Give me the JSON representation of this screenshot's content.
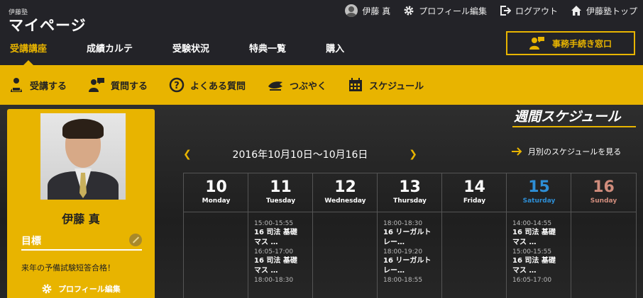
{
  "header": {
    "brand_small": "伊藤塾",
    "brand_title": "マイページ",
    "user_name": "伊藤 真",
    "profile_edit": "プロフィール編集",
    "logout": "ログアウト",
    "home": "伊藤塾トップ",
    "office_button": "事務手続き窓口"
  },
  "nav": {
    "tabs": [
      {
        "label": "受講講座",
        "active": true
      },
      {
        "label": "成績カルテ"
      },
      {
        "label": "受験状況"
      },
      {
        "label": "特典一覧"
      },
      {
        "label": "購入"
      }
    ]
  },
  "subnav": {
    "items": [
      {
        "label": "受講する",
        "icon": "lecture-icon"
      },
      {
        "label": "質問する",
        "icon": "question-person-icon"
      },
      {
        "label": "よくある質問",
        "icon": "faq-icon"
      },
      {
        "label": "つぶやく",
        "icon": "tweet-icon"
      },
      {
        "label": "スケジュール",
        "icon": "calendar-icon"
      }
    ]
  },
  "profile": {
    "name": "伊藤 真",
    "goal_label": "目標",
    "goal_text": "来年の予備試験短答合格！",
    "edit_label": "プロフィール編集"
  },
  "schedule": {
    "title": "週間スケジュール",
    "range": "2016年10月10日～10月16日",
    "monthly_link": "月別のスケジュールを見る",
    "days": [
      {
        "num": "10",
        "name": "Monday",
        "events": []
      },
      {
        "num": "11",
        "name": "Tuesday",
        "events": [
          {
            "time": "15:00-15:55",
            "title": "16 司法 基礎",
            "title2": "マス …"
          },
          {
            "time": "16:05-17:00",
            "title": "16 司法 基礎",
            "title2": "マス …"
          },
          {
            "time": "18:00-18:30",
            "title": "",
            "title2": ""
          }
        ]
      },
      {
        "num": "12",
        "name": "Wednesday",
        "events": []
      },
      {
        "num": "13",
        "name": "Thursday",
        "events": [
          {
            "time": "18:00-18:30",
            "title": "16 リーガルト",
            "title2": "レー…"
          },
          {
            "time": "18:00-19:20",
            "title": "16 リーガルト",
            "title2": "レー…"
          },
          {
            "time": "18:00-18:55",
            "title": "",
            "title2": ""
          }
        ]
      },
      {
        "num": "14",
        "name": "Friday",
        "events": []
      },
      {
        "num": "15",
        "name": "Saturday",
        "events": [
          {
            "time": "14:00-14:55",
            "title": "16 司法 基礎",
            "title2": "マス …"
          },
          {
            "time": "15:00-15:55",
            "title": "16 司法 基礎",
            "title2": "マス …"
          },
          {
            "time": "16:05-17:00",
            "title": "",
            "title2": ""
          }
        ]
      },
      {
        "num": "16",
        "name": "Sunday",
        "events": []
      }
    ]
  },
  "colors": {
    "accent": "#e8b400",
    "saturday": "#2e8fd6",
    "sunday": "#d08c7c"
  }
}
